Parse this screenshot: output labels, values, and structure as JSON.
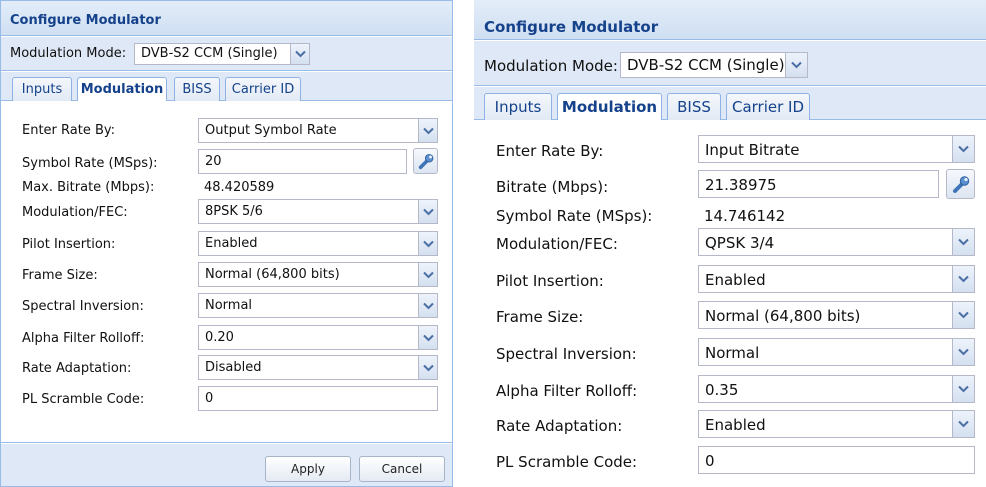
{
  "panels": [
    {
      "title": "Configure Modulator",
      "mode": {
        "label": "Modulation Mode:",
        "value": "DVB-S2 CCM (Single)"
      },
      "tabs": [
        "Inputs",
        "Modulation",
        "BISS",
        "Carrier ID"
      ],
      "active_tab": "Modulation",
      "fields": {
        "enter_rate_by": {
          "label": "Enter Rate By:",
          "value": "Output Symbol Rate"
        },
        "rate_input": {
          "label": "Symbol Rate (MSps):",
          "value": "20"
        },
        "derived": {
          "label": "Max. Bitrate (Mbps):",
          "value": "48.420589"
        },
        "modulation_fec": {
          "label": "Modulation/FEC:",
          "value": "8PSK 5/6"
        },
        "pilot_insertion": {
          "label": "Pilot Insertion:",
          "value": "Enabled"
        },
        "frame_size": {
          "label": "Frame Size:",
          "value": "Normal (64,800 bits)"
        },
        "spectral_inversion": {
          "label": "Spectral Inversion:",
          "value": "Normal"
        },
        "alpha_rolloff": {
          "label": "Alpha Filter Rolloff:",
          "value": "0.20"
        },
        "rate_adaptation": {
          "label": "Rate Adaptation:",
          "value": "Disabled"
        },
        "pl_scramble": {
          "label": "PL Scramble Code:",
          "value": "0"
        }
      },
      "buttons": {
        "apply": "Apply",
        "cancel": "Cancel"
      }
    },
    {
      "title": "Configure Modulator",
      "mode": {
        "label": "Modulation Mode:",
        "value": "DVB-S2 CCM (Single)"
      },
      "tabs": [
        "Inputs",
        "Modulation",
        "BISS",
        "Carrier ID"
      ],
      "active_tab": "Modulation",
      "fields": {
        "enter_rate_by": {
          "label": "Enter Rate By:",
          "value": "Input Bitrate"
        },
        "rate_input": {
          "label": "Bitrate (Mbps):",
          "value": "21.38975"
        },
        "derived": {
          "label": "Symbol Rate (MSps):",
          "value": "14.746142"
        },
        "modulation_fec": {
          "label": "Modulation/FEC:",
          "value": "QPSK 3/4"
        },
        "pilot_insertion": {
          "label": "Pilot Insertion:",
          "value": "Enabled"
        },
        "frame_size": {
          "label": "Frame Size:",
          "value": "Normal (64,800 bits)"
        },
        "spectral_inversion": {
          "label": "Spectral Inversion:",
          "value": "Normal"
        },
        "alpha_rolloff": {
          "label": "Alpha Filter Rolloff:",
          "value": "0.35"
        },
        "rate_adaptation": {
          "label": "Rate Adaptation:",
          "value": "Enabled"
        },
        "pl_scramble": {
          "label": "PL Scramble Code:",
          "value": "0"
        }
      }
    }
  ],
  "icons": {
    "dropdown": "chevron-down-icon",
    "calculate": "wrench-icon"
  },
  "colors": {
    "title_text": "#15428b",
    "header_bg": "#dfe8f6",
    "border": "#99bbe8",
    "icon_blue": "#4a7fc0"
  }
}
